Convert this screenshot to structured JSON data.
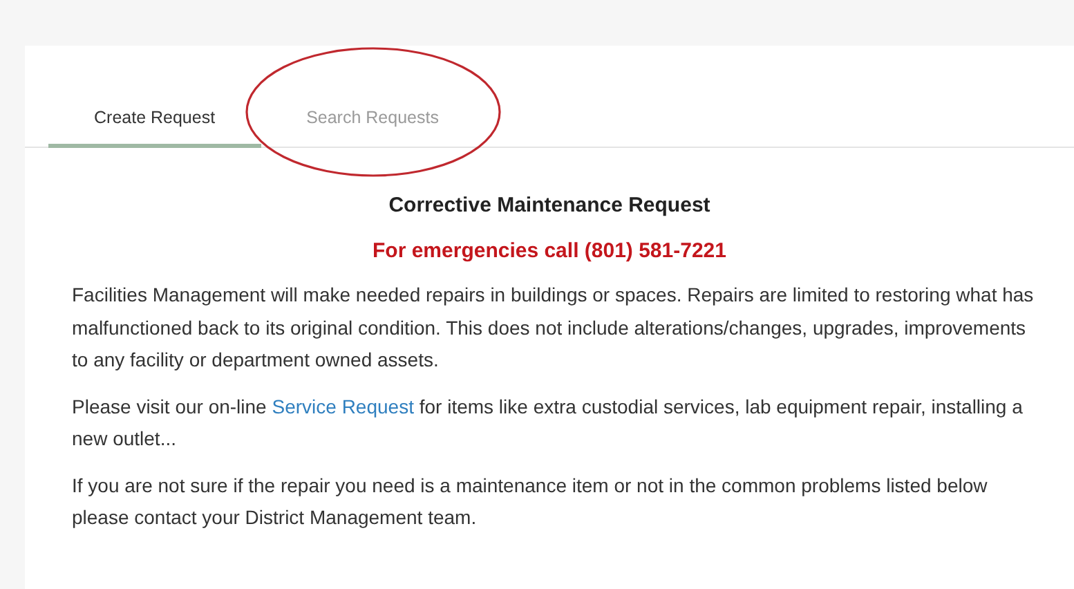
{
  "tabs": [
    {
      "label": "Create Request",
      "selected": true,
      "circled": false
    },
    {
      "label": "Search Requests",
      "selected": false,
      "circled": true
    }
  ],
  "heading": "Corrective Maintenance Request",
  "emergency_notice": "For emergencies call (801) 581-7221",
  "paragraphs": [
    {
      "parts": [
        {
          "kind": "text",
          "text": "Facilities Management will make needed repairs in buildings or spaces. Repairs are limited to restoring what has malfunctioned back to its original condition. This does not include alterations/changes, upgrades, improvements to any facility or department owned assets."
        }
      ]
    },
    {
      "parts": [
        {
          "kind": "text",
          "text": "Please visit our on-line "
        },
        {
          "kind": "link",
          "text": "Service Request"
        },
        {
          "kind": "text",
          "text": " for items like extra custodial services, lab equipment repair, installing a new outlet..."
        }
      ]
    },
    {
      "parts": [
        {
          "kind": "text",
          "text": "If you are not sure if the repair you need is a maintenance item or not in the common problems listed below please contact your District Management team."
        }
      ]
    }
  ]
}
